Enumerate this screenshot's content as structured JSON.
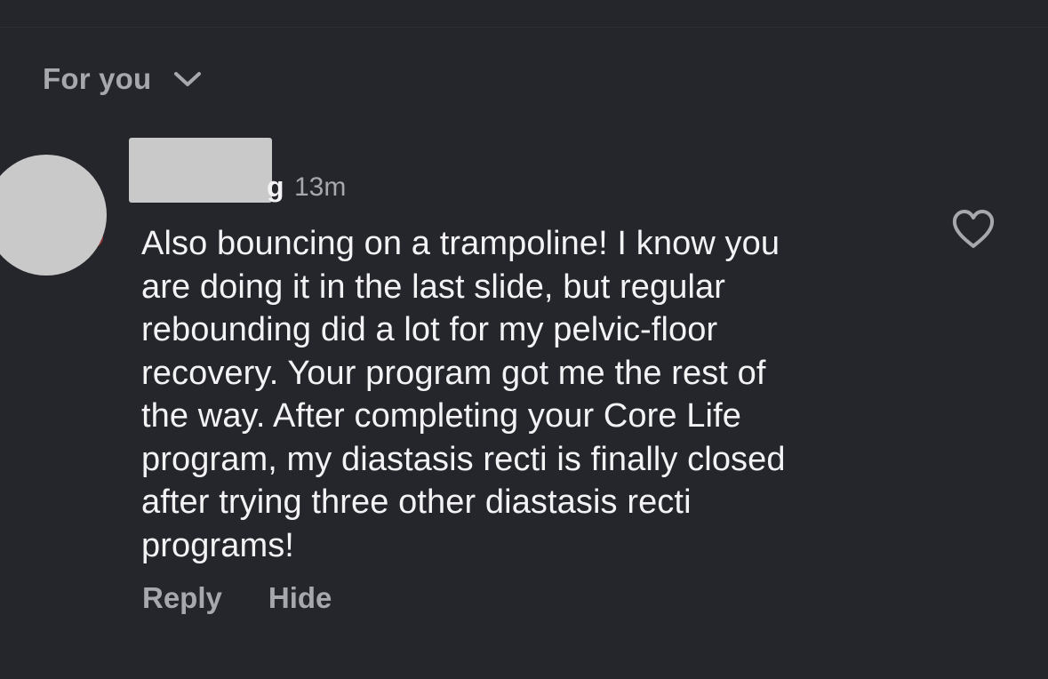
{
  "feed_filter": {
    "label": "For you",
    "icon": "chevron-down-icon"
  },
  "comment": {
    "username_visible_fragment": "g",
    "timestamp": "13m",
    "text": "Also bouncing on a trampoline! I know you\nare doing it in the last slide, but regular\nrebounding did a lot for my pelvic-floor\nrecovery. Your program got me the rest of\nthe way. After completing your Core Life\nprogram, my diastasis recti is finally closed\nafter trying three other diastasis recti\nprograms!",
    "like_icon": "heart-outline-icon",
    "actions": {
      "reply": "Reply",
      "hide": "Hide"
    }
  },
  "colors": {
    "background": "#25262b",
    "primary_text": "#f3f3f5",
    "secondary_text": "#a6a8ad",
    "redaction": "#c9c9c9"
  }
}
